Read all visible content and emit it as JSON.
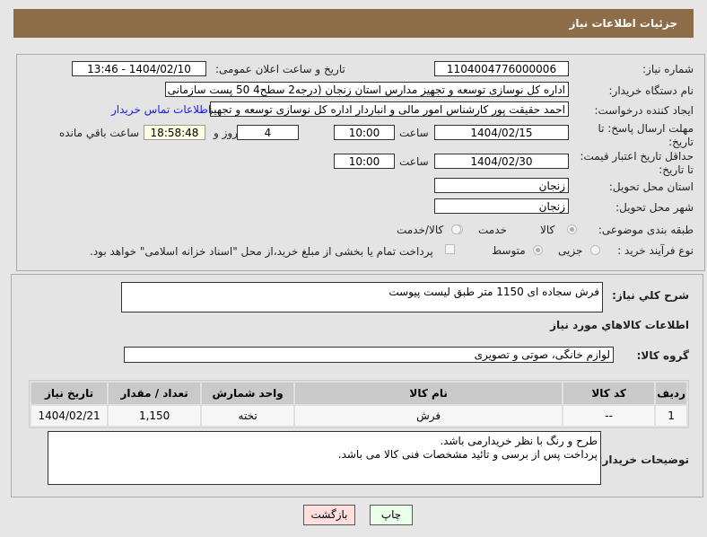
{
  "header": {
    "title": "جزئیات اطلاعات نیاز"
  },
  "form": {
    "need_number_label": "شماره نیاز:",
    "need_number": "1104004776000006",
    "announce_label": "تاریخ و ساعت اعلان عمومی:",
    "announce_value": "1404/02/10 - 13:46",
    "buyer_label": "نام دستگاه خریدار:",
    "buyer_value": "اداره کل نوسازی   توسعه و تجهیز مدارس استان زنجان (درجه2  سطح4  50 پست سازمانی",
    "creator_label": "ایجاد کننده درخواست:",
    "creator_value": "احمد حقیقت پور کارشناس امور مالی و انباردار اداره کل نوسازی   توسعه و تجهیز",
    "contact_link": "اطلاعات تماس خریدار",
    "deadline_label": "مهلت ارسال پاسخ: تا تاریخ:",
    "deadline_date": "1404/02/15",
    "time_label": "ساعت",
    "deadline_time": "10:00",
    "days": "4",
    "days_label": "روز و",
    "remaining": "18:58:48",
    "remaining_label": "ساعت باقي مانده",
    "validity_label": "حداقل تاریخ اعتبار قیمت: تا تاریخ:",
    "validity_date": "1404/02/30",
    "validity_time": "10:00",
    "province_label": "استان محل تحویل:",
    "province": "زنجان",
    "city_label": "شهر محل تحویل:",
    "city": "زنجان",
    "category_label": "طبقه بندی موضوعی:",
    "category_options": [
      "کالا",
      "خدمت",
      "کالا/خدمت"
    ],
    "category_selected": "کالا",
    "process_label": "نوع فرآیند خرید :",
    "process_options": [
      "جزیی",
      "متوسط"
    ],
    "process_selected": "متوسط",
    "payment_text": "پرداخت تمام یا بخشی از مبلغ خرید،از محل \"اسناد خزانه اسلامی\" خواهد بود."
  },
  "details": {
    "desc_label": "شرح کلي نياز:",
    "desc_value": "فرش سجاده ای 1150 متر طبق لیست پیوست",
    "goods_heading": "اطلاعات کالاهاي مورد نياز",
    "group_label": "گروه کالا:",
    "group_value": "لوازم خانگی، صوتی و تصویری",
    "table": {
      "headers": [
        "ردیف",
        "کد کالا",
        "نام کالا",
        "واحد شمارش",
        "تعداد / مقدار",
        "تاریخ نیاز"
      ],
      "rows": [
        [
          "1",
          "--",
          "فرش",
          "تخته",
          "1,150",
          "1404/02/21"
        ]
      ]
    },
    "notes_label": "توضیحات خریدار:",
    "notes_lines": [
      "طرح و رنگ با نظر خریدارمی باشد.",
      "پرداخت پس از برسی و تائید مشخصات فنی کالا می باشد."
    ]
  },
  "buttons": {
    "print": "چاپ",
    "back": "بازگشت"
  },
  "colors": {
    "header": "#8d6c48",
    "link": "#1a1aff",
    "remaining_bg": "#ffffe0",
    "back_bg": "#ffdede",
    "print_bg": "#eaffea"
  }
}
